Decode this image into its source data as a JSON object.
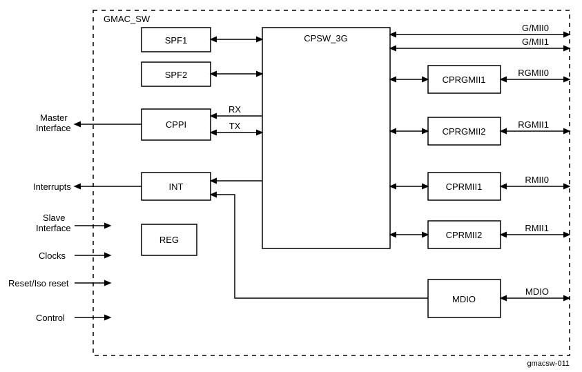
{
  "container": {
    "label": "GMAC_SW"
  },
  "central": {
    "label": "CPSW_3G"
  },
  "left_boxes": {
    "spf1": "SPF1",
    "spf2": "SPF2",
    "cppi": "CPPI",
    "int": "INT",
    "reg": "REG"
  },
  "right_boxes": {
    "cprgmii1": "CPRGMII1",
    "cprgmii2": "CPRGMII2",
    "cprmii1": "CPRMII1",
    "cprmii2": "CPRMII2",
    "mdio": "MDIO"
  },
  "cppi_labels": {
    "rx": "RX",
    "tx": "TX"
  },
  "left_ext": {
    "master": "Master\nInterface",
    "interrupts": "Interrupts",
    "slave": "Slave\nInterface",
    "clocks": "Clocks",
    "reset": "Reset/Iso reset",
    "control": "Control"
  },
  "right_ext": {
    "gmii0": "G/MII0",
    "gmii1": "G/MII1",
    "rgmii0": "RGMII0",
    "rgmii1": "RGMII1",
    "rmii0": "RMII0",
    "rmii1": "RMII1",
    "mdio": "MDIO"
  },
  "figure_id": "gmacsw-011"
}
